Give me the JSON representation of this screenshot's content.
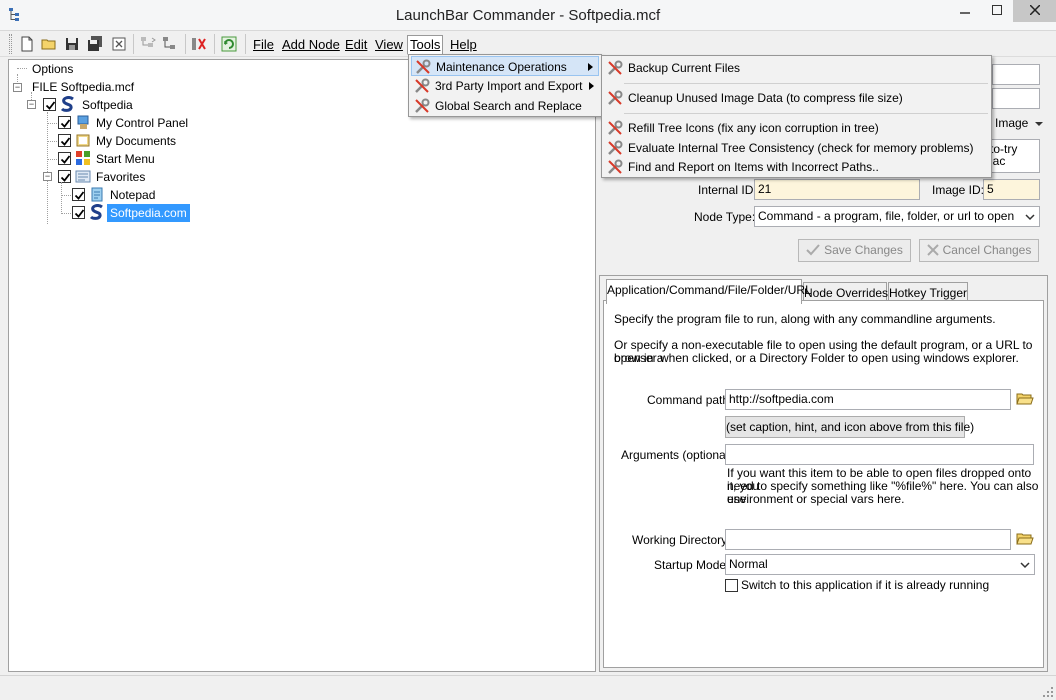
{
  "window": {
    "title": "LaunchBar Commander - Softpedia.mcf"
  },
  "menubar": {
    "file": "File",
    "add_node": "Add Node",
    "edit": "Edit",
    "view": "View",
    "tools": "Tools",
    "help": "Help"
  },
  "toolbar_icons": [
    "new-file-icon",
    "open-folder-icon",
    "save-icon",
    "save-all-icon",
    "close-file-icon",
    "move-node-icon",
    "add-child-icon",
    "cut-node-icon",
    "refresh-icon"
  ],
  "tools_menu": {
    "items": [
      {
        "label": "Maintenance Operations",
        "has_submenu": true
      },
      {
        "label": "3rd Party Import and Export",
        "has_submenu": true
      },
      {
        "label": "Global Search and Replace",
        "has_submenu": false
      }
    ]
  },
  "maintenance_submenu": {
    "items": [
      {
        "label": "Backup Current Files"
      },
      {
        "label": "Cleanup Unused Image Data (to compress file size)"
      },
      {
        "label": "Refill Tree Icons (fix any icon corruption in tree)"
      },
      {
        "label": "Evaluate Internal Tree Consistency (check for memory problems)"
      },
      {
        "label": "Find and Report on Items with Incorrect Paths.."
      }
    ]
  },
  "tree": {
    "options": "Options",
    "file": "FILE Softpedia.mcf",
    "root": "Softpedia",
    "items": [
      {
        "label": "My Control Panel",
        "checked": true
      },
      {
        "label": "My Documents",
        "checked": true
      },
      {
        "label": "Start Menu",
        "checked": true
      },
      {
        "label": "Favorites",
        "checked": true
      }
    ],
    "favorites": [
      {
        "label": "Notepad",
        "checked": true
      },
      {
        "label": "Softpedia.com",
        "checked": true,
        "selected": true
      }
    ]
  },
  "node_props": {
    "image_dropdown": "Image",
    "partial_right_text_1": "to-try",
    "partial_right_text_2": "lac",
    "internal_id_label": "Internal ID:",
    "internal_id_value": "21",
    "image_id_label": "Image ID:",
    "image_id_value": "5",
    "node_type_label": "Node Type:",
    "node_type_value": "Command - a program, file, folder, or url to open",
    "save_changes": "Save Changes",
    "cancel_changes": "Cancel Changes"
  },
  "tabs": [
    {
      "label": "Application/Command/File/Folder/URL",
      "active": true
    },
    {
      "label": "Node Overrides",
      "active": false
    },
    {
      "label": "Hotkey Trigger",
      "active": false
    }
  ],
  "command_tab": {
    "intro1": "Specify the program file to run, along with any commandline arguments.",
    "intro2_line1": "Or specify a non-executable file to open using the default program, or a URL to open in a",
    "intro2_line2": "browser when clicked, or a Directory Folder to open using windows explorer.",
    "command_path_label": "Command path:",
    "command_path_value": "http://softpedia.com",
    "set_caption_button": "(set caption, hint, and icon above from this file)",
    "arguments_label": "Arguments (optional):",
    "arguments_value": "",
    "arguments_help_line1": "If you want this item to be able to open files dropped onto it, you",
    "arguments_help_line2": "need to specify something like \"%file%\" here.  You can also use",
    "arguments_help_line3": "environment or special vars here.",
    "working_dir_label": "Working Directory:",
    "working_dir_value": "",
    "startup_mode_label": "Startup Mode:",
    "startup_mode_value": "Normal",
    "switch_checkbox_label": "Switch to this application if it is already running",
    "switch_checked": false
  },
  "colors": {
    "selection": "#3399ff",
    "menu_highlight": "#d5e5f7",
    "id_field": "#fdf5dc"
  }
}
